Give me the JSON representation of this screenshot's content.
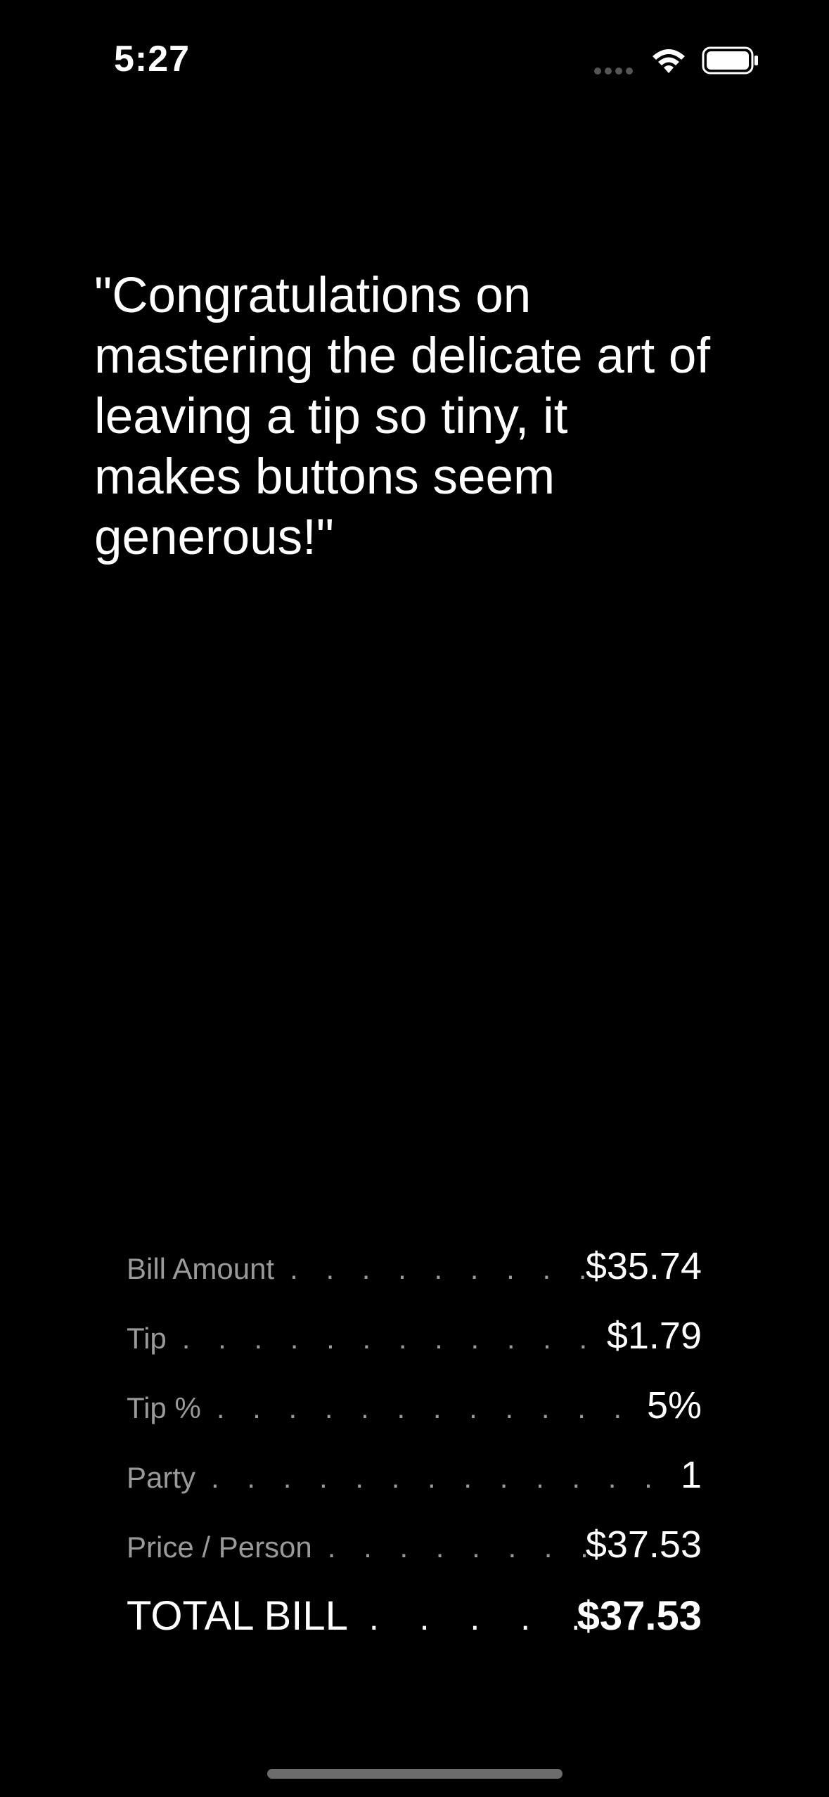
{
  "status_bar": {
    "time": "5:27",
    "icons": [
      "cellular-signal-icon",
      "wifi-icon",
      "battery-icon"
    ]
  },
  "message": {
    "text": "\"Congratulations on mastering the delicate art of leaving a tip so tiny, it makes buttons seem generous!\""
  },
  "receipt": {
    "rows": [
      {
        "label": "Bill Amount",
        "value": "$35.74"
      },
      {
        "label": "Tip",
        "value": "$1.79"
      },
      {
        "label": "Tip %",
        "value": "5%"
      },
      {
        "label": "Party",
        "value": "1"
      },
      {
        "label": "Price / Person",
        "value": "$37.53"
      }
    ],
    "total": {
      "label": "TOTAL BILL",
      "value": "$37.53"
    }
  },
  "colors": {
    "background": "#000000",
    "primary_text": "#ffffff",
    "secondary_text": "#9a9a9a"
  }
}
